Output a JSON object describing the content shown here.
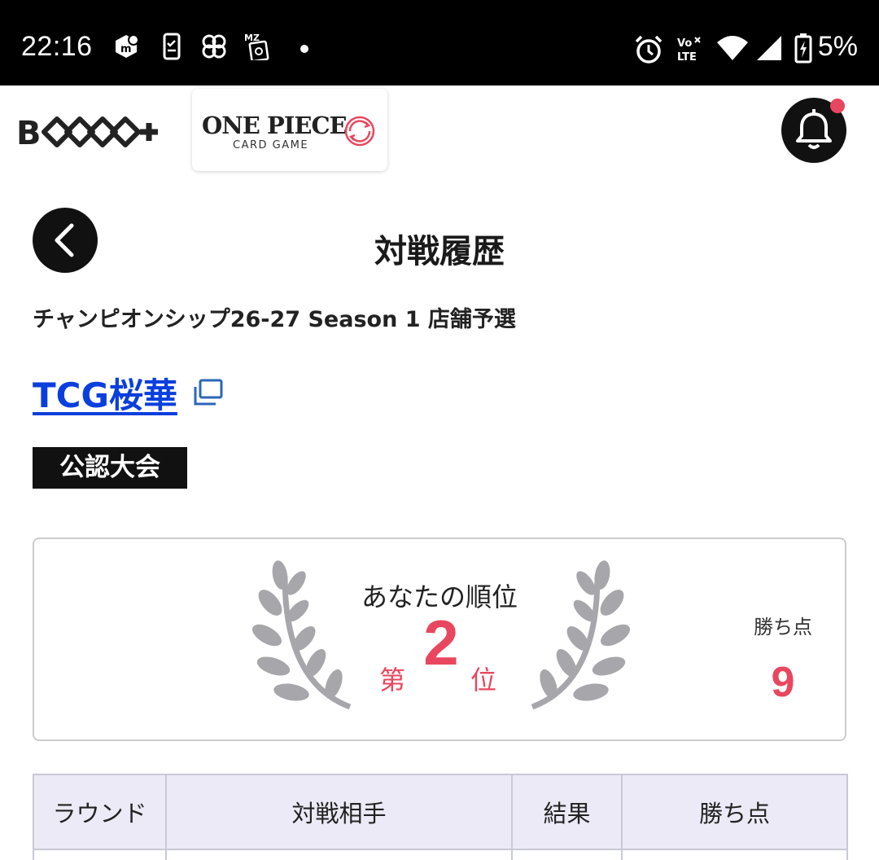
{
  "status_bar": {
    "time": "22:16",
    "left_icons": [
      "messenger-app-icon",
      "phone-clipboard-icon",
      "pinwheel-icon",
      "card-app-icon",
      "dot-icon"
    ],
    "right_icons": [
      "alarm-icon",
      "volte-icon",
      "wifi-icon",
      "signal-icon",
      "battery-charging-icon"
    ],
    "volte_label": "Vo LTE",
    "battery": "5%"
  },
  "header": {
    "brand": "BTCG+",
    "game_title": "ONE PIECE",
    "game_subtitle": "CARD GAME",
    "notification_dot_color": "#e8475f"
  },
  "page": {
    "title": "対戦履歴",
    "event_name": "チャンピオンシップ26-27 Season 1 店舗予選",
    "shop_name": "TCG桜華",
    "badge": "公認大会"
  },
  "rank_card": {
    "label": "あなたの順位",
    "prefix": "第",
    "rank": "2",
    "suffix": "位",
    "points_label": "勝ち点",
    "points": "9"
  },
  "table": {
    "headers": [
      "ラウンド",
      "対戦相手",
      "結果",
      "勝ち点"
    ]
  },
  "colors": {
    "accent": "#e8475f",
    "link": "#0a3fdd",
    "table_header_bg": "#eceaf6",
    "laurel": "#a7a7ab"
  }
}
